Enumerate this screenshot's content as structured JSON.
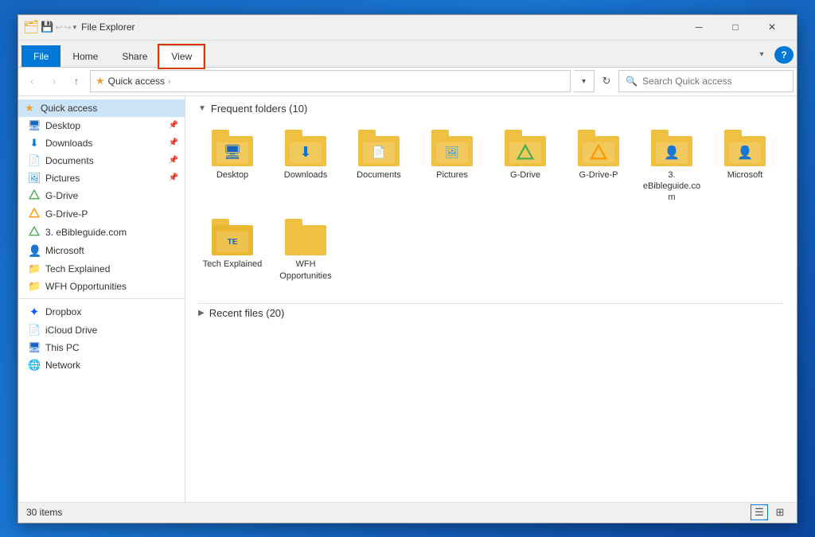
{
  "window": {
    "title": "File Explorer",
    "items_count": "30 items"
  },
  "titlebar": {
    "icon": "🗂",
    "qs_icons": [
      "💾",
      "📋",
      "↩"
    ],
    "dropdown": "▾",
    "controls": {
      "minimize": "─",
      "maximize": "□",
      "close": "✕"
    }
  },
  "ribbon": {
    "tabs": [
      {
        "label": "File",
        "state": "normal"
      },
      {
        "label": "Home",
        "state": "normal"
      },
      {
        "label": "Share",
        "state": "normal"
      },
      {
        "label": "View",
        "state": "highlighted"
      }
    ]
  },
  "addressbar": {
    "back": "‹",
    "forward": "›",
    "up": "↑",
    "star_icon": "★",
    "path": "Quick access",
    "path_chevron": "›",
    "dropdown": "▾",
    "refresh": "↻",
    "search_placeholder": "Search Quick access"
  },
  "sidebar": {
    "quick_access": {
      "label": "Quick access",
      "items": [
        {
          "name": "Desktop",
          "icon": "🖥",
          "pinned": true,
          "color": "#1565c0"
        },
        {
          "name": "Downloads",
          "icon": "⬇",
          "pinned": true,
          "color": "#0078d7"
        },
        {
          "name": "Documents",
          "icon": "📄",
          "pinned": true,
          "color": "#1565c0"
        },
        {
          "name": "Pictures",
          "icon": "🖼",
          "pinned": true,
          "color": "#2196f3"
        },
        {
          "name": "G-Drive",
          "icon": "△",
          "pinned": false,
          "color": "#4CAF50"
        },
        {
          "name": "G-Drive-P",
          "icon": "△",
          "pinned": false,
          "color": "#FF9800"
        },
        {
          "name": "3. eBibleguide.com",
          "icon": "△",
          "pinned": false,
          "color": "#4CAF50"
        },
        {
          "name": "Microsoft",
          "icon": "👤",
          "pinned": false,
          "color": "#1565c0"
        },
        {
          "name": "Tech Explained",
          "icon": "📁",
          "pinned": false,
          "color": "#e6a817"
        },
        {
          "name": "WFH Opportunities",
          "icon": "📁",
          "pinned": false,
          "color": "#e6a817"
        }
      ]
    },
    "other_items": [
      {
        "name": "Dropbox",
        "icon": "✦",
        "color": "#0061ff"
      },
      {
        "name": "iCloud Drive",
        "icon": "📄",
        "color": "#888"
      },
      {
        "name": "This PC",
        "icon": "🖥",
        "color": "#1565c0"
      },
      {
        "name": "Network",
        "icon": "🌐",
        "color": "#1565c0"
      }
    ]
  },
  "content": {
    "frequent_folders_header": "Frequent folders (10)",
    "recent_files_header": "Recent files (20)",
    "folders": [
      {
        "name": "Desktop",
        "type": "desktop"
      },
      {
        "name": "Downloads",
        "type": "download"
      },
      {
        "name": "Documents",
        "type": "doc"
      },
      {
        "name": "Pictures",
        "type": "pic"
      },
      {
        "name": "G-Drive",
        "type": "gdrive"
      },
      {
        "name": "G-Drive-P",
        "type": "gdrivep"
      },
      {
        "name": "3. eBibleguide.com",
        "type": "person"
      },
      {
        "name": "Microsoft",
        "type": "person"
      },
      {
        "name": "Tech Explained",
        "type": "tech"
      },
      {
        "name": "WFH Opportunities",
        "type": "plain"
      }
    ]
  },
  "statusbar": {
    "items_count": "30 items",
    "view_list_icon": "☰",
    "view_grid_icon": "⊞"
  }
}
